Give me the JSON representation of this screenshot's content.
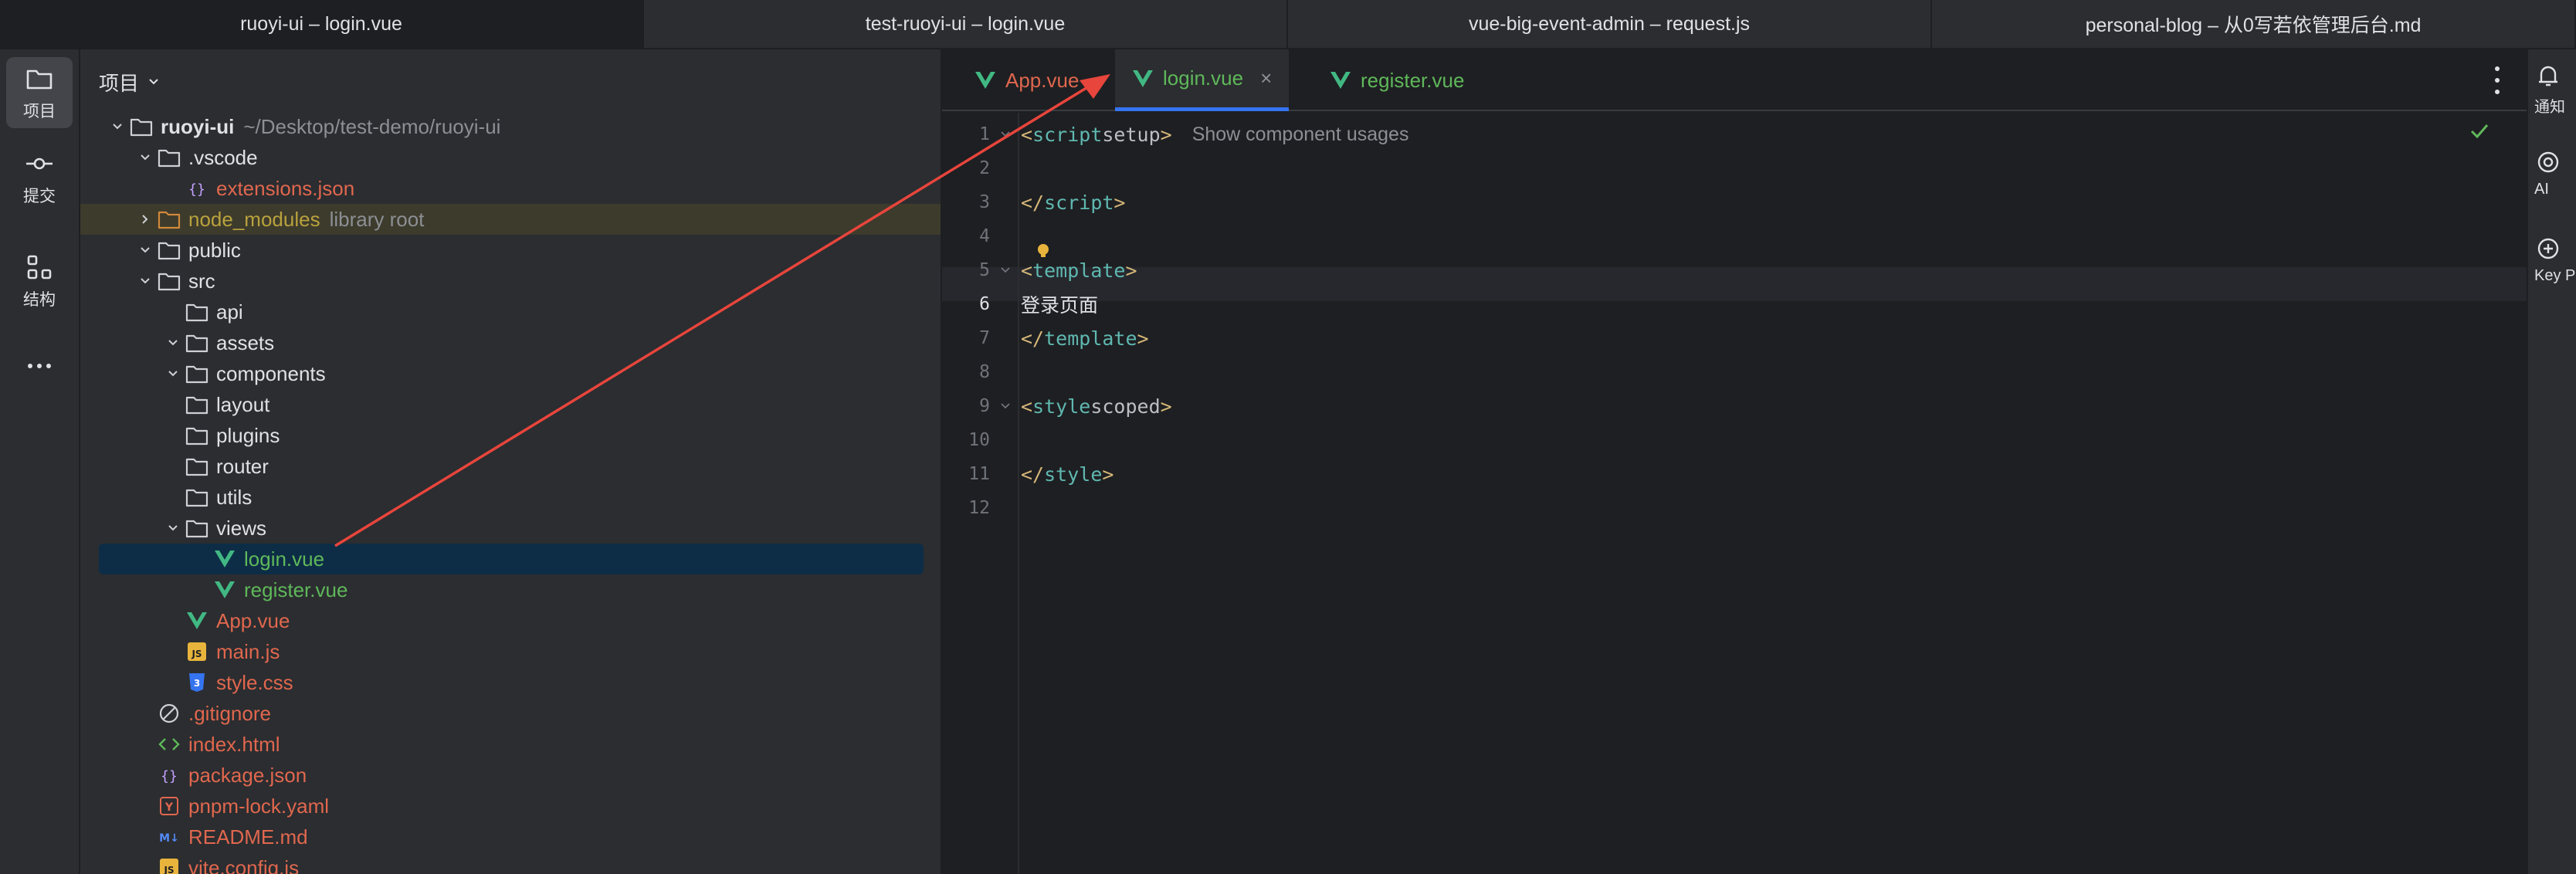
{
  "window_tabs": [
    {
      "label": "ruoyi-ui – login.vue",
      "active": true
    },
    {
      "label": "test-ruoyi-ui – login.vue",
      "active": false
    },
    {
      "label": "vue-big-event-admin – request.js",
      "active": false
    },
    {
      "label": "personal-blog – 从0写若依管理后台.md",
      "active": false
    }
  ],
  "left_bar": {
    "items": [
      {
        "label": "项目",
        "icon": "folder-icon"
      },
      {
        "label": "提交",
        "icon": "commit-icon"
      },
      {
        "label": "结构",
        "icon": "structure-icon"
      }
    ]
  },
  "project_panel": {
    "title": "项目",
    "tree": [
      {
        "name": "ruoyi-ui",
        "extra": "~/Desktop/test-demo/ruoyi-ui",
        "icon": "folder",
        "chev": "down",
        "depth": 0,
        "color": "white",
        "bold": true
      },
      {
        "name": ".vscode",
        "icon": "folder",
        "chev": "down",
        "depth": 1,
        "color": "white"
      },
      {
        "name": "extensions.json",
        "icon": "json",
        "depth": 2,
        "color": "red"
      },
      {
        "name": "node_modules",
        "extra": "library root",
        "icon": "folder-orange",
        "chev": "right",
        "depth": 1,
        "color": "olive",
        "highlight": true
      },
      {
        "name": "public",
        "icon": "folder",
        "chev": "down",
        "depth": 1,
        "color": "white"
      },
      {
        "name": "src",
        "icon": "folder",
        "chev": "down",
        "depth": 1,
        "color": "white"
      },
      {
        "name": "api",
        "icon": "folder",
        "depth": 2,
        "color": "white"
      },
      {
        "name": "assets",
        "icon": "folder",
        "chev": "down",
        "depth": 2,
        "color": "white"
      },
      {
        "name": "components",
        "icon": "folder",
        "chev": "down",
        "depth": 2,
        "color": "white"
      },
      {
        "name": "layout",
        "icon": "folder",
        "depth": 2,
        "color": "white"
      },
      {
        "name": "plugins",
        "icon": "folder",
        "depth": 2,
        "color": "white"
      },
      {
        "name": "router",
        "icon": "folder",
        "depth": 2,
        "color": "white"
      },
      {
        "name": "utils",
        "icon": "folder",
        "depth": 2,
        "color": "white"
      },
      {
        "name": "views",
        "icon": "folder",
        "chev": "down",
        "depth": 2,
        "color": "white"
      },
      {
        "name": "login.vue",
        "icon": "vue",
        "depth": 3,
        "color": "green",
        "selected": true
      },
      {
        "name": "register.vue",
        "icon": "vue",
        "depth": 3,
        "color": "green"
      },
      {
        "name": "App.vue",
        "icon": "vue",
        "depth": 2,
        "color": "red"
      },
      {
        "name": "main.js",
        "icon": "js",
        "depth": 2,
        "color": "red"
      },
      {
        "name": "style.css",
        "icon": "css",
        "depth": 2,
        "color": "red"
      },
      {
        "name": ".gitignore",
        "icon": "ignore",
        "depth": 1,
        "color": "red"
      },
      {
        "name": "index.html",
        "icon": "html",
        "depth": 1,
        "color": "red"
      },
      {
        "name": "package.json",
        "icon": "json",
        "depth": 1,
        "color": "red"
      },
      {
        "name": "pnpm-lock.yaml",
        "icon": "yaml",
        "depth": 1,
        "color": "red"
      },
      {
        "name": "README.md",
        "icon": "md",
        "depth": 1,
        "color": "red"
      },
      {
        "name": "vite.config.js",
        "icon": "js",
        "depth": 1,
        "color": "red"
      }
    ]
  },
  "editor": {
    "tabs": [
      {
        "label": "App.vue",
        "color": "red",
        "active": false
      },
      {
        "label": "login.vue",
        "color": "green",
        "active": true,
        "close": "×"
      },
      {
        "label": "register.vue",
        "color": "green",
        "active": false
      }
    ],
    "line_numbers": [
      "1",
      "2",
      "3",
      "4",
      "5",
      "6",
      "7",
      "8",
      "9",
      "10",
      "11",
      "12"
    ],
    "current_line": "6",
    "code": {
      "l1_open": "<",
      "l1_tag": "script",
      "l1_attr": " setup",
      "l1_close": ">",
      "l1_hint": "Show component usages",
      "l3_open": "</",
      "l3_tag": "script",
      "l3_close": ">",
      "l5_open": "<",
      "l5_tag": "template",
      "l5_close": ">",
      "l6_text": "登录页面",
      "l7_open": "</",
      "l7_tag": "template",
      "l7_close": ">",
      "l9_open": "<",
      "l9_tag": "style",
      "l9_attr": " scoped",
      "l9_close": ">",
      "l11_open": "</",
      "l11_tag": "style",
      "l11_close": ">"
    }
  },
  "right_bar": {
    "items": [
      {
        "label": "通知",
        "icon": "bell-icon"
      },
      {
        "label": "AI",
        "icon": "ai-icon"
      },
      {
        "label": "Key P",
        "icon": "key-promoter-icon"
      }
    ]
  },
  "colors": {
    "accent": "#3574f0",
    "arrow": "#e8453c",
    "vue": "#41b883"
  }
}
